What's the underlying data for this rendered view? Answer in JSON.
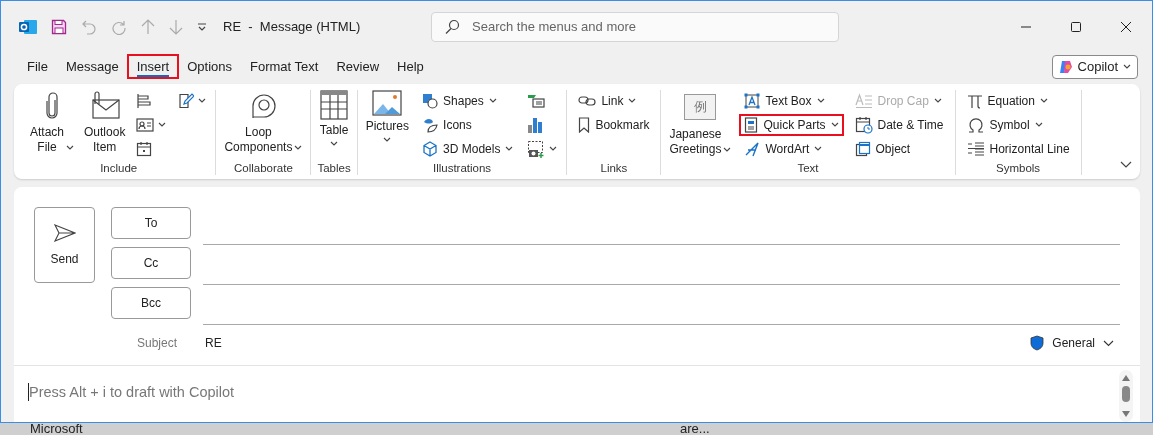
{
  "title_bar": {
    "title": "RE  -  Message (HTML)",
    "search_placeholder": "Search the menus and more"
  },
  "tabs": [
    {
      "label": "File",
      "selected": false,
      "highlighted": false
    },
    {
      "label": "Message",
      "selected": false,
      "highlighted": false
    },
    {
      "label": "Insert",
      "selected": true,
      "highlighted": true
    },
    {
      "label": "Options",
      "selected": false,
      "highlighted": false
    },
    {
      "label": "Format Text",
      "selected": false,
      "highlighted": false
    },
    {
      "label": "Review",
      "selected": false,
      "highlighted": false
    },
    {
      "label": "Help",
      "selected": false,
      "highlighted": false
    }
  ],
  "copilot_button": {
    "label": "Copilot"
  },
  "ribbon_groups": [
    {
      "name": "Include",
      "columns": [
        {
          "kind": "large",
          "items": [
            {
              "label": "Attach File",
              "dropdown": true,
              "caret_below": false
            }
          ]
        },
        {
          "kind": "large",
          "items": [
            {
              "label": "Outlook Item",
              "dropdown": false
            }
          ]
        },
        {
          "kind": "icons",
          "items": [
            {
              "dropdown": false
            },
            {
              "dropdown": true
            },
            {
              "dropdown": false
            }
          ]
        },
        {
          "kind": "icons",
          "items": [
            {
              "dropdown": true
            }
          ]
        }
      ]
    },
    {
      "name": "Collaborate",
      "columns": [
        {
          "kind": "large",
          "items": [
            {
              "label": "Loop Components",
              "dropdown": true,
              "caret_below": false
            }
          ]
        }
      ]
    },
    {
      "name": "Tables",
      "columns": [
        {
          "kind": "large",
          "items": [
            {
              "label": "Table",
              "dropdown": true,
              "caret_below": true
            }
          ]
        }
      ]
    },
    {
      "name": "Illustrations",
      "columns": [
        {
          "kind": "large",
          "items": [
            {
              "label": "Pictures",
              "dropdown": true,
              "caret_below": true
            }
          ]
        },
        {
          "kind": "small",
          "items": [
            {
              "label": "Shapes",
              "dropdown": true,
              "disabled": false,
              "highlighted": false
            },
            {
              "label": "Icons",
              "dropdown": false,
              "disabled": false,
              "highlighted": false
            },
            {
              "label": "3D Models",
              "dropdown": true,
              "disabled": false,
              "highlighted": false
            }
          ]
        },
        {
          "kind": "icons",
          "items": [
            {
              "dropdown": false
            },
            {
              "dropdown": false
            },
            {
              "dropdown": true
            }
          ]
        }
      ]
    },
    {
      "name": "Links",
      "columns": [
        {
          "kind": "small",
          "items": [
            {
              "label": "Link",
              "dropdown": true,
              "disabled": false,
              "highlighted": false
            },
            {
              "label": "Bookmark",
              "dropdown": false,
              "disabled": false,
              "highlighted": false
            }
          ]
        }
      ]
    },
    {
      "name": "Text",
      "columns": [
        {
          "kind": "large",
          "items": [
            {
              "label": "Japanese Greetings",
              "dropdown": true,
              "caret_below": false,
              "icon_text": "例"
            }
          ]
        },
        {
          "kind": "small",
          "items": [
            {
              "label": "Text Box",
              "dropdown": true,
              "disabled": false,
              "highlighted": false
            },
            {
              "label": "Quick Parts",
              "dropdown": true,
              "disabled": false,
              "highlighted": true
            },
            {
              "label": "WordArt",
              "dropdown": true,
              "disabled": false,
              "highlighted": false
            }
          ]
        },
        {
          "kind": "small",
          "items": [
            {
              "label": "Drop Cap",
              "dropdown": true,
              "disabled": true,
              "highlighted": false
            },
            {
              "label": "Date & Time",
              "dropdown": false,
              "disabled": false,
              "highlighted": false
            },
            {
              "label": "Object",
              "dropdown": false,
              "disabled": false,
              "highlighted": false
            }
          ]
        }
      ]
    },
    {
      "name": "Symbols",
      "columns": [
        {
          "kind": "small",
          "items": [
            {
              "label": "Equation",
              "dropdown": true,
              "disabled": false,
              "highlighted": false
            },
            {
              "label": "Symbol",
              "dropdown": true,
              "disabled": false,
              "highlighted": false
            },
            {
              "label": "Horizontal Line",
              "dropdown": false,
              "disabled": false,
              "highlighted": false
            }
          ]
        }
      ]
    }
  ],
  "compose": {
    "send_label": "Send",
    "address_buttons": [
      "To",
      "Cc",
      "Bcc"
    ],
    "subject_label": "Subject",
    "subject_value": "RE",
    "sensitivity": "General",
    "body_placeholder": "Press Alt + i to draft with Copilot"
  },
  "background_texts": [
    "Microsoft",
    "are..."
  ]
}
